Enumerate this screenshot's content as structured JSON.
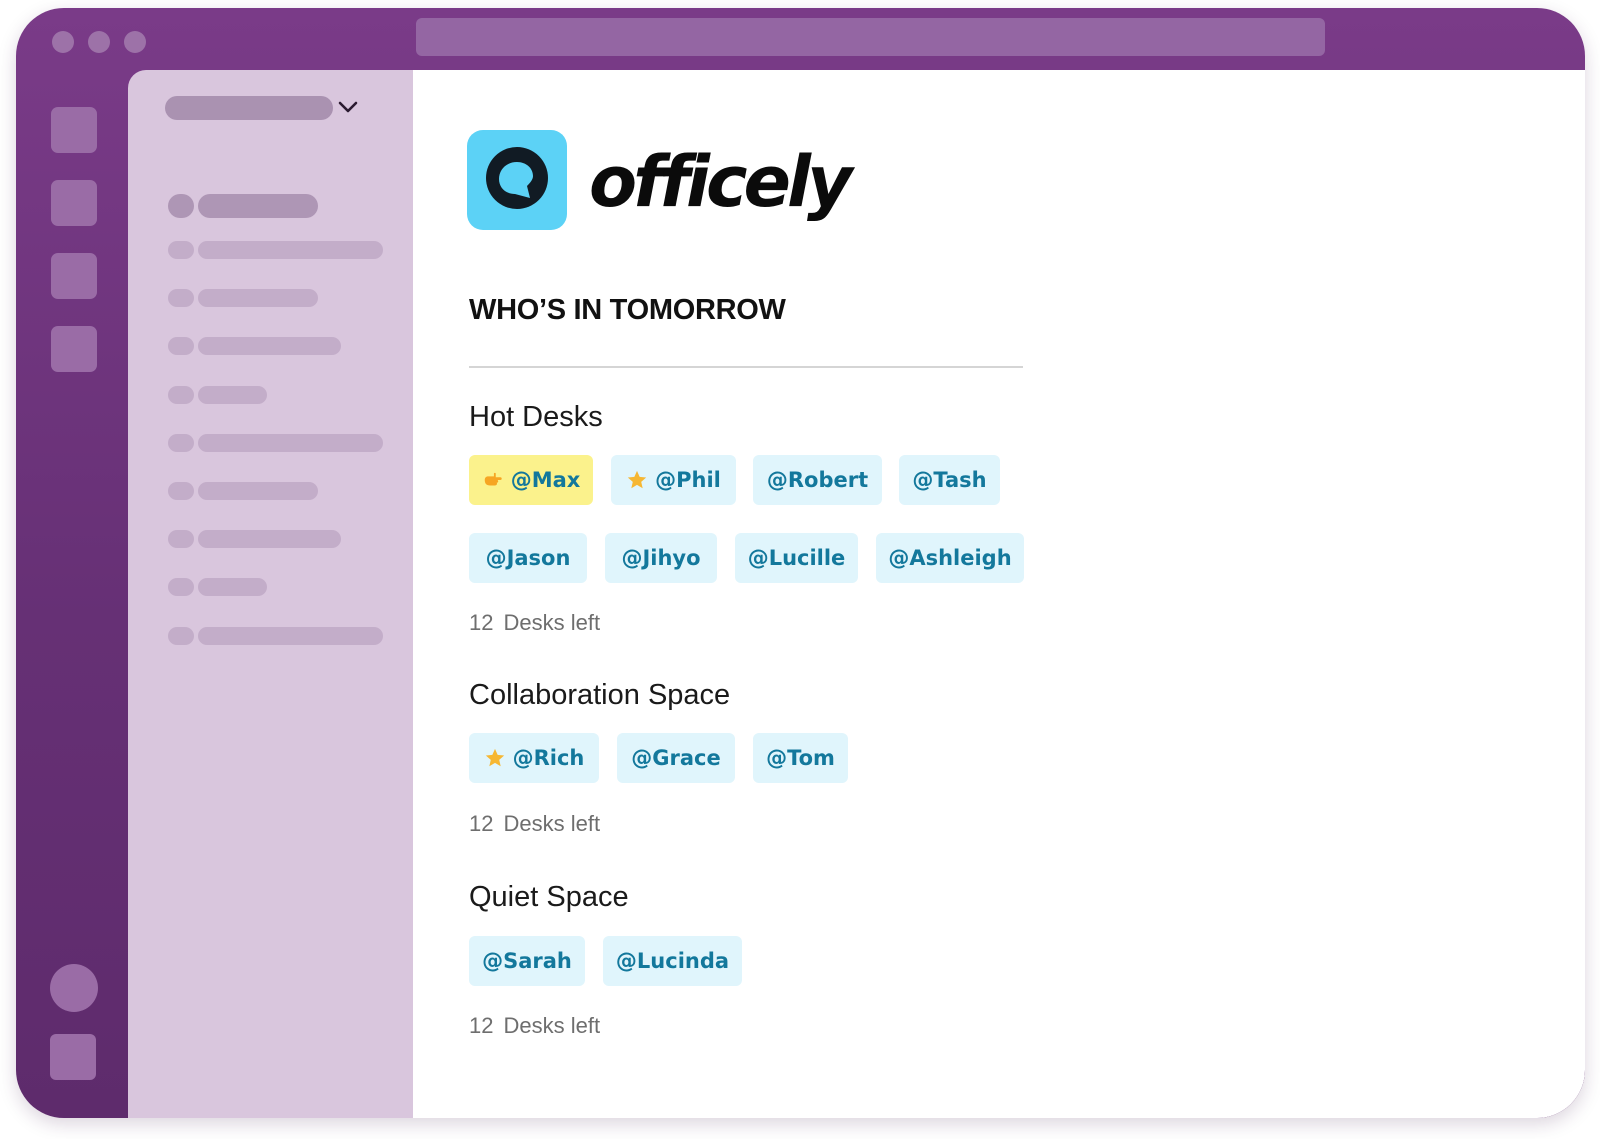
{
  "brand": {
    "name": "officely",
    "tile_color": "#5cd2f6"
  },
  "window": {
    "frame_color": "#6b327a",
    "sidebar_color": "#d9c6dd"
  },
  "section_title": "WHO’S IN TOMORROW",
  "groups": [
    {
      "name": "Hot Desks",
      "count": "12",
      "count_label": "Desks left",
      "people": [
        {
          "handle": "@Max",
          "icon": "pointing-hand-icon",
          "highlight": true
        },
        {
          "handle": "@Phil",
          "icon": "star-icon"
        },
        {
          "handle": "@Robert"
        },
        {
          "handle": "@Tash"
        },
        {
          "handle": "@Jason"
        },
        {
          "handle": "@Jihyo"
        },
        {
          "handle": "@Lucille"
        },
        {
          "handle": "@Ashleigh"
        }
      ]
    },
    {
      "name": "Collaboration Space",
      "count": "12",
      "count_label": "Desks left",
      "people": [
        {
          "handle": "@Rich",
          "icon": "star-icon"
        },
        {
          "handle": "@Grace"
        },
        {
          "handle": "@Tom"
        }
      ]
    },
    {
      "name": "Quiet Space",
      "count": "12",
      "count_label": "Desks left",
      "people": [
        {
          "handle": "@Sarah"
        },
        {
          "handle": "@Lucinda"
        }
      ]
    }
  ],
  "colors": {
    "chip_background": "#e0f5fc",
    "chip_text": "#13789c",
    "chip_highlight": "#fbf28c",
    "star": "#f6b733"
  }
}
